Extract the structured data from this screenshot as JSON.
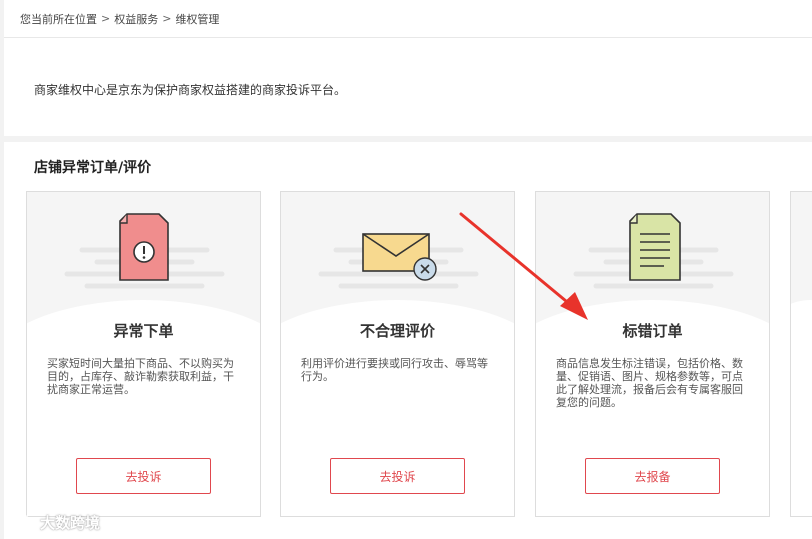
{
  "breadcrumb": {
    "items": [
      "您当前所在位置",
      "权益服务",
      "维权管理"
    ],
    "separator": ">"
  },
  "notice": {
    "text": "商家维权中心是京东为保护商家权益搭建的商家投诉平台。"
  },
  "section": {
    "title": "店铺异常订单/评价"
  },
  "cards": [
    {
      "title": "异常下单",
      "description": "买家短时间大量拍下商品、不以购买为目的，占库存、敲诈勒索获取利益，干扰商家正常运营。",
      "button_label": "去投诉",
      "icon": "document-alert-icon"
    },
    {
      "title": "不合理评价",
      "description": "利用评价进行要挟或同行攻击、辱骂等行为。",
      "button_label": "去投诉",
      "icon": "envelope-close-icon"
    },
    {
      "title": "标错订单",
      "description": "商品信息发生标注错误，包括价格、数量、促销语、图片、规格参数等，可点此了解处理流，报备后会有专属客服回复您的问题。",
      "button_label": "去报备",
      "icon": "document-lines-icon"
    }
  ],
  "watermark": {
    "text": "大数跨境"
  },
  "colors": {
    "accent": "#e0484e",
    "arrow": "#e8332b",
    "alert_doc": "#f08d8d",
    "envelope": "#f7d98f",
    "lines_doc": "#d9e4a6"
  }
}
